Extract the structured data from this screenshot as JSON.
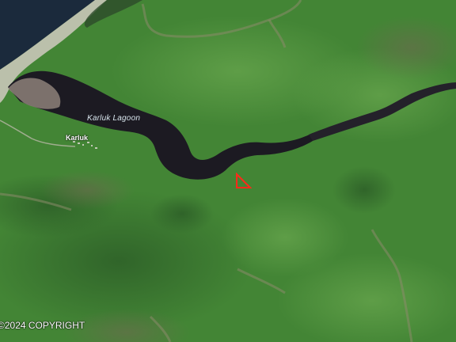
{
  "map": {
    "labels": {
      "lagoon": "Karluk Lagoon",
      "town": "Karluk"
    },
    "copyright": "©2024 COPYRIGHT",
    "colors": {
      "land": "#3f7f34",
      "land_light": "#5a9a44",
      "land_dark": "#2e5f2a",
      "water": "#1b2a3c",
      "river": "#1c1a22",
      "beach": "#c9c7b8",
      "parcel_outline": "#ff2a1a"
    },
    "features": [
      "ocean",
      "gravel-spit",
      "karluk-lagoon",
      "karluk-river",
      "road",
      "village",
      "property-parcel-marker"
    ]
  }
}
